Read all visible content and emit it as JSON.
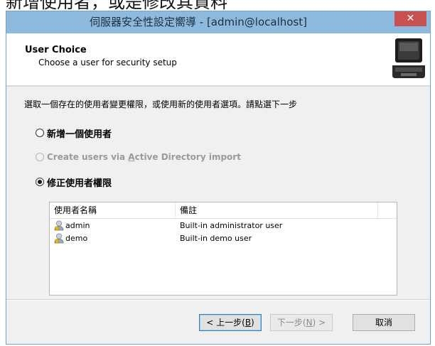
{
  "background_caption": "新增使用者，或是修改其資料",
  "window": {
    "title": "伺服器安全性設定嚮導 - [admin@localhost]",
    "close_glyph": "✕",
    "titlebar_color": "#8dbadc",
    "close_color": "#c75050"
  },
  "header": {
    "title": "User Choice",
    "subtitle": "Choose a user for security setup",
    "icon": "laptop-icon"
  },
  "instruction": "選取一個存在的使用者變更權限，或使用新的使用者選項。請點選下一步",
  "options": [
    {
      "label": "新增一個使用者",
      "selected": false,
      "enabled": true
    },
    {
      "label_pre": "Create users via ",
      "label_mnemonic": "A",
      "label_post": "ctive Directory import",
      "selected": false,
      "enabled": false
    },
    {
      "label": "修正使用者權限",
      "selected": true,
      "enabled": true
    }
  ],
  "user_list": {
    "columns": [
      "使用者名稱",
      "備註"
    ],
    "rows": [
      {
        "name": "admin",
        "note": "Built-in administrator user",
        "icon": "user-icon"
      },
      {
        "name": "demo",
        "note": "Built-in demo user",
        "icon": "user-icon"
      }
    ]
  },
  "buttons": {
    "back": {
      "pre": "< 上一步(",
      "mnemonic": "B",
      "post": ")"
    },
    "next": {
      "pre": "下一步(",
      "mnemonic": "N",
      "post": ") >"
    },
    "cancel": "取消"
  }
}
